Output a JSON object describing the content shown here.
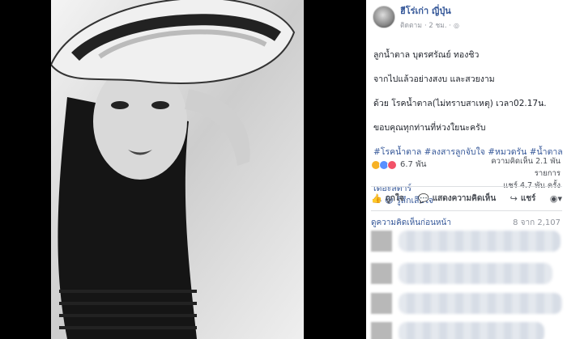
{
  "post": {
    "author": "ฮีโร่เก่า ญี่ปุ่น",
    "follow_label": "ติดตาม",
    "time": "· 2 ชม. ·",
    "globe_icon": "globe-icon",
    "line1": "ลูกน้ำตาล บุตรศรัณย์ ทองชิว",
    "line2": "จากไปแล้วอย่างสงบ และสวยงาม",
    "line3": "ด้วย โรคน้ำตาล(ไม่ทราบสาเหตุ) เวลา02.17น.",
    "line4": "ขอบคุณทุกท่านที่ห่วงใยนะครับ",
    "hashtags1": "#โรคน้ำตาล #ลงสารลูกจับใจ #หมวดรัน #น้ำตาล",
    "hashtags2": "เดอะสตาร์",
    "feeling": "— 😢 รู้สึกเสียใจ"
  },
  "reactions": {
    "count": "6.7 พัน",
    "comments": "ความคิดเห็น 2.1 พัน รายการ",
    "shares": "แชร์ 4.7 พัน ครั้ง"
  },
  "actions": {
    "like": "ถูกใจ",
    "comment": "แสดงความคิดเห็น",
    "share": "แชร์",
    "like_icon": "👍",
    "comment_icon": "💬",
    "share_icon": "↪",
    "audience_icon": "◉▾"
  },
  "comments": {
    "prev_label": "ดูความคิดเห็นก่อนหน้า",
    "prev_count": "8 จาก 2,107"
  }
}
